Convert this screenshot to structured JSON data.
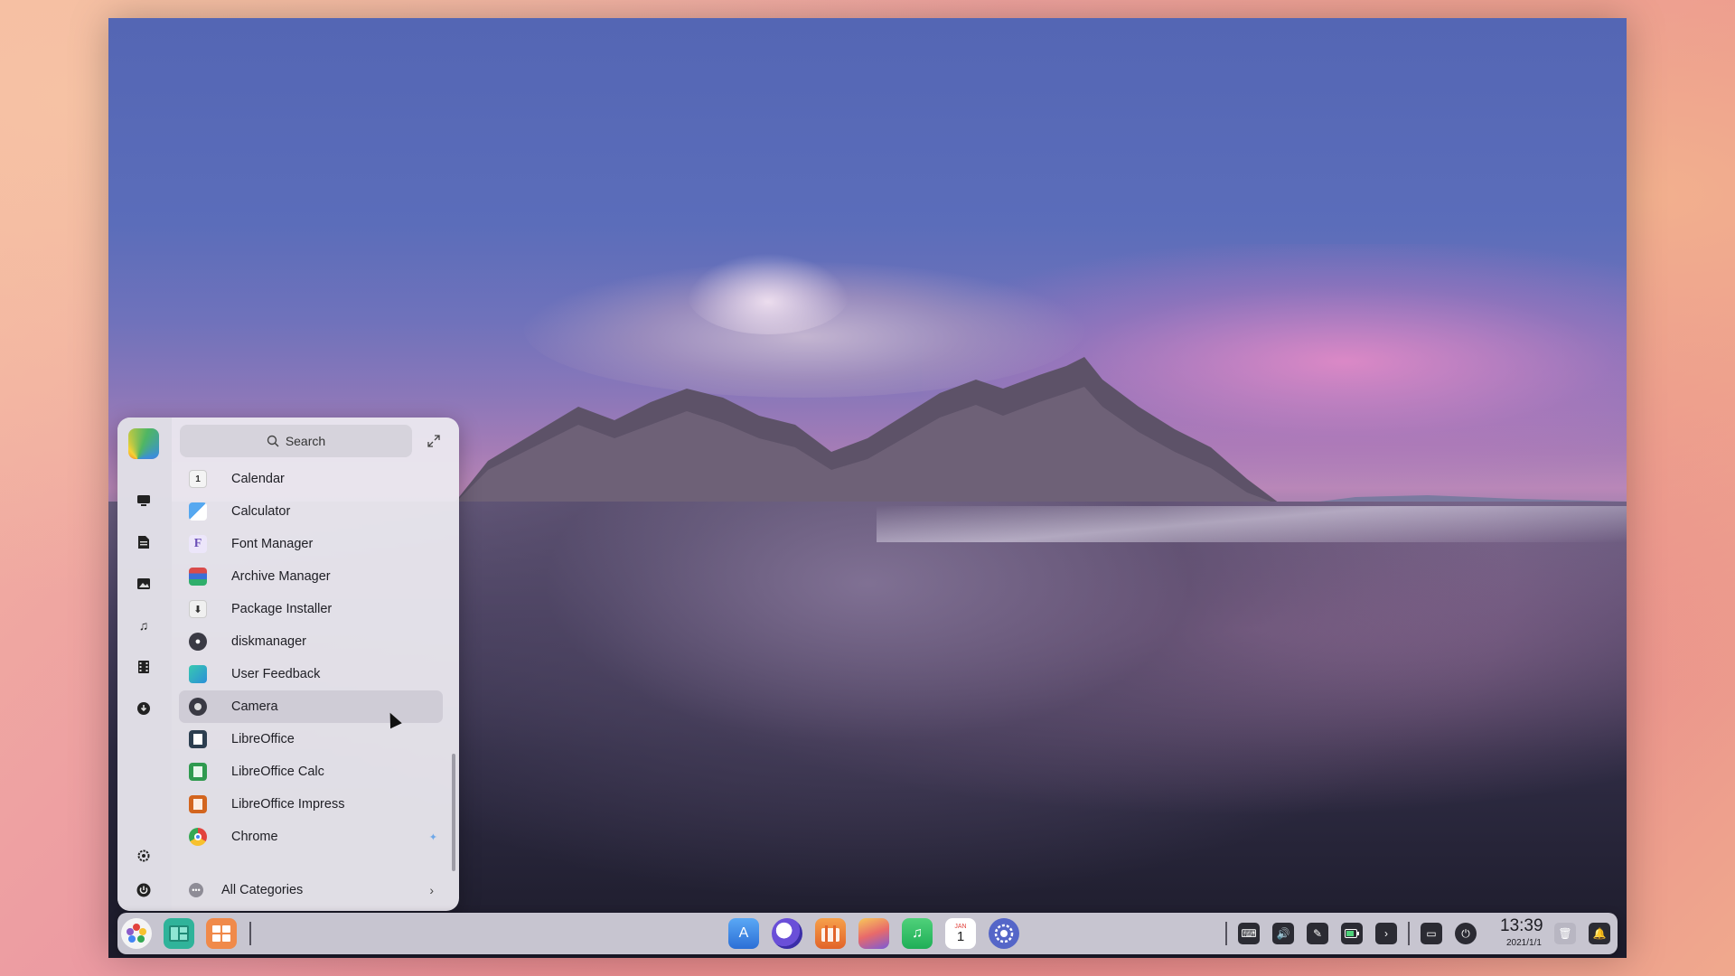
{
  "launcher": {
    "search_placeholder": "Search",
    "apps": [
      {
        "label": "Calendar",
        "icon": "calendar-icon",
        "color": "#f4f4f4"
      },
      {
        "label": "Calculator",
        "icon": "calculator-icon",
        "color": "#3f8fe0"
      },
      {
        "label": "Font Manager",
        "icon": "font-manager-icon",
        "color": "#e8e4f6"
      },
      {
        "label": "Archive Manager",
        "icon": "archive-manager-icon",
        "color": "#c94a4a"
      },
      {
        "label": "Package Installer",
        "icon": "package-installer-icon",
        "color": "#f0f0f0"
      },
      {
        "label": "diskmanager",
        "icon": "diskmanager-icon",
        "color": "#3a3a44"
      },
      {
        "label": "User Feedback",
        "icon": "user-feedback-icon",
        "color": "#2bb3a0"
      },
      {
        "label": "Camera",
        "icon": "camera-icon",
        "color": "#3a3a44"
      },
      {
        "label": "LibreOffice",
        "icon": "libreoffice-icon",
        "color": "#2c3e50"
      },
      {
        "label": "LibreOffice Calc",
        "icon": "libreoffice-calc-icon",
        "color": "#2f9a4f"
      },
      {
        "label": "LibreOffice Impress",
        "icon": "libreoffice-impress-icon",
        "color": "#d3651e"
      },
      {
        "label": "Chrome",
        "icon": "chrome-icon",
        "color": "#e2433d"
      }
    ],
    "all_categories": "All Categories"
  },
  "clock": {
    "time": "13:39",
    "date": "2021/1/1"
  },
  "calendar_icon": {
    "month": "JAN",
    "day": "1"
  }
}
